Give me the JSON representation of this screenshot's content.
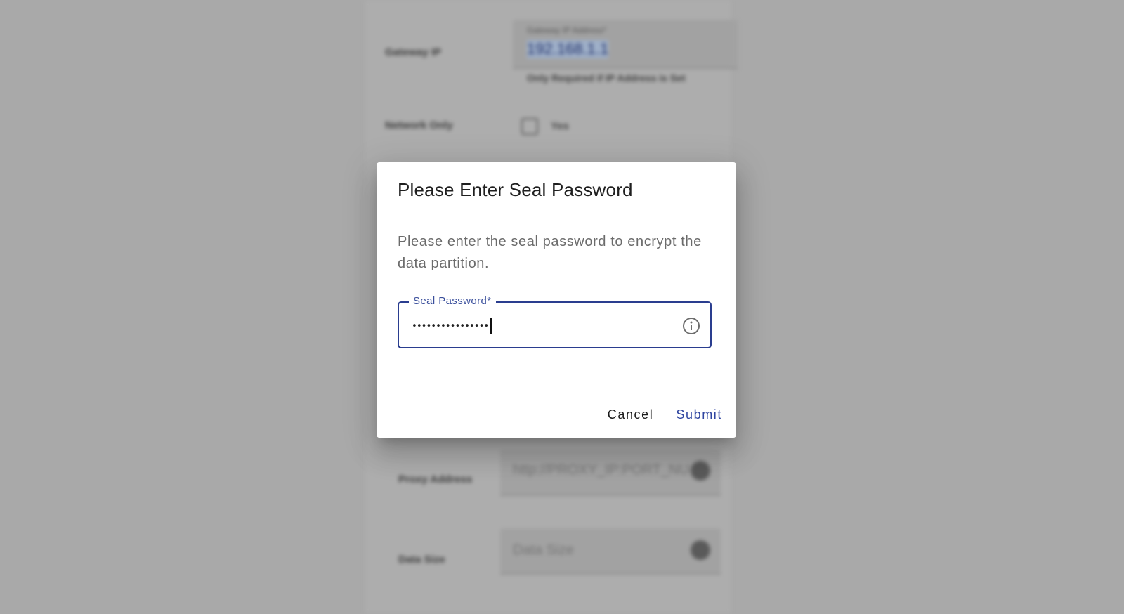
{
  "background": {
    "gateway": {
      "label": "Gateway IP",
      "field_label": "Gateway IP Address*",
      "value": "192.168.1.1",
      "help": "Only Required if IP Address is Set"
    },
    "network_only": {
      "label": "Network Only",
      "checkbox_label": "Yes"
    },
    "proxy": {
      "label": "Proxy Address",
      "placeholder": "http://PROXY_IP:PORT_NU"
    },
    "data_size": {
      "label": "Data Size",
      "placeholder": "Data Size"
    }
  },
  "dialog": {
    "title": "Please Enter Seal Password",
    "text": "Please enter the seal password to encrypt the data partition.",
    "field": {
      "label": "Seal Password*",
      "value": "••••••••••••••••"
    },
    "info_icon": "info-icon",
    "cancel_label": "Cancel",
    "submit_label": "Submit"
  },
  "colors": {
    "accent": "#2f45a0",
    "overlay": "#a9a9a9"
  }
}
